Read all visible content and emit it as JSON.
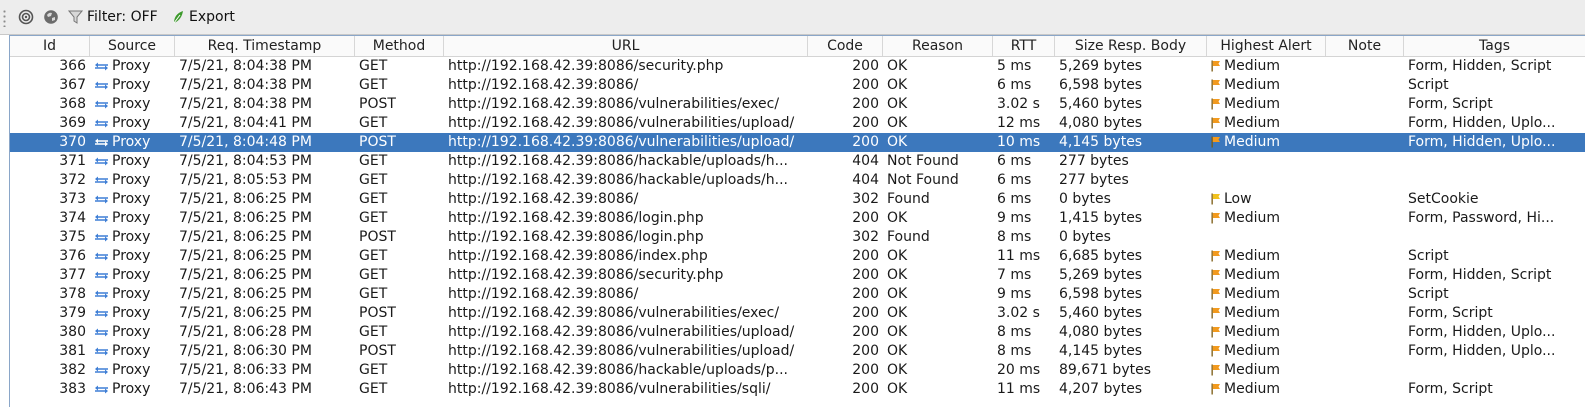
{
  "toolbar": {
    "filter_label": "Filter: OFF",
    "export_label": "Export"
  },
  "columns": [
    "Id",
    "Source",
    "Req. Timestamp",
    "Method",
    "URL",
    "Code",
    "Reason",
    "RTT",
    "Size Resp. Body",
    "Highest Alert",
    "Note",
    "Tags"
  ],
  "colors": {
    "selected_row": "#3c78bd",
    "arrow": "#3f7fd6",
    "medium_flag": "#f29a1e",
    "low_flag": "#f2c21e"
  },
  "rows": [
    {
      "id": "366",
      "source": "Proxy",
      "timestamp": "7/5/21, 8:04:38 PM",
      "method": "GET",
      "url": "http://192.168.42.39:8086/security.php",
      "code": "200",
      "reason": "OK",
      "rtt": "5 ms",
      "size": "5,269 bytes",
      "alert": "Medium",
      "note": "",
      "tags": "Form, Hidden, Script"
    },
    {
      "id": "367",
      "source": "Proxy",
      "timestamp": "7/5/21, 8:04:38 PM",
      "method": "GET",
      "url": "http://192.168.42.39:8086/",
      "code": "200",
      "reason": "OK",
      "rtt": "6 ms",
      "size": "6,598 bytes",
      "alert": "Medium",
      "note": "",
      "tags": "Script"
    },
    {
      "id": "368",
      "source": "Proxy",
      "timestamp": "7/5/21, 8:04:38 PM",
      "method": "POST",
      "url": "http://192.168.42.39:8086/vulnerabilities/exec/",
      "code": "200",
      "reason": "OK",
      "rtt": "3.02 s",
      "size": "5,460 bytes",
      "alert": "Medium",
      "note": "",
      "tags": "Form, Script"
    },
    {
      "id": "369",
      "source": "Proxy",
      "timestamp": "7/5/21, 8:04:41 PM",
      "method": "GET",
      "url": "http://192.168.42.39:8086/vulnerabilities/upload/",
      "code": "200",
      "reason": "OK",
      "rtt": "12 ms",
      "size": "4,080 bytes",
      "alert": "Medium",
      "note": "",
      "tags": "Form, Hidden, Uplo..."
    },
    {
      "id": "370",
      "source": "Proxy",
      "timestamp": "7/5/21, 8:04:48 PM",
      "method": "POST",
      "url": "http://192.168.42.39:8086/vulnerabilities/upload/",
      "code": "200",
      "reason": "OK",
      "rtt": "10 ms",
      "size": "4,145 bytes",
      "alert": "Medium",
      "note": "",
      "tags": "Form, Hidden, Uplo...",
      "selected": true
    },
    {
      "id": "371",
      "source": "Proxy",
      "timestamp": "7/5/21, 8:04:53 PM",
      "method": "GET",
      "url": "http://192.168.42.39:8086/hackable/uploads/h...",
      "code": "404",
      "reason": "Not Found",
      "rtt": "6 ms",
      "size": "277 bytes",
      "alert": "",
      "note": "",
      "tags": ""
    },
    {
      "id": "372",
      "source": "Proxy",
      "timestamp": "7/5/21, 8:05:53 PM",
      "method": "GET",
      "url": "http://192.168.42.39:8086/hackable/uploads/h...",
      "code": "404",
      "reason": "Not Found",
      "rtt": "6 ms",
      "size": "277 bytes",
      "alert": "",
      "note": "",
      "tags": ""
    },
    {
      "id": "373",
      "source": "Proxy",
      "timestamp": "7/5/21, 8:06:25 PM",
      "method": "GET",
      "url": "http://192.168.42.39:8086/",
      "code": "302",
      "reason": "Found",
      "rtt": "6 ms",
      "size": "0 bytes",
      "alert": "Low",
      "note": "",
      "tags": "SetCookie"
    },
    {
      "id": "374",
      "source": "Proxy",
      "timestamp": "7/5/21, 8:06:25 PM",
      "method": "GET",
      "url": "http://192.168.42.39:8086/login.php",
      "code": "200",
      "reason": "OK",
      "rtt": "9 ms",
      "size": "1,415 bytes",
      "alert": "Medium",
      "note": "",
      "tags": "Form, Password, Hi..."
    },
    {
      "id": "375",
      "source": "Proxy",
      "timestamp": "7/5/21, 8:06:25 PM",
      "method": "POST",
      "url": "http://192.168.42.39:8086/login.php",
      "code": "302",
      "reason": "Found",
      "rtt": "8 ms",
      "size": "0 bytes",
      "alert": "",
      "note": "",
      "tags": ""
    },
    {
      "id": "376",
      "source": "Proxy",
      "timestamp": "7/5/21, 8:06:25 PM",
      "method": "GET",
      "url": "http://192.168.42.39:8086/index.php",
      "code": "200",
      "reason": "OK",
      "rtt": "11 ms",
      "size": "6,685 bytes",
      "alert": "Medium",
      "note": "",
      "tags": "Script"
    },
    {
      "id": "377",
      "source": "Proxy",
      "timestamp": "7/5/21, 8:06:25 PM",
      "method": "GET",
      "url": "http://192.168.42.39:8086/security.php",
      "code": "200",
      "reason": "OK",
      "rtt": "7 ms",
      "size": "5,269 bytes",
      "alert": "Medium",
      "note": "",
      "tags": "Form, Hidden, Script"
    },
    {
      "id": "378",
      "source": "Proxy",
      "timestamp": "7/5/21, 8:06:25 PM",
      "method": "GET",
      "url": "http://192.168.42.39:8086/",
      "code": "200",
      "reason": "OK",
      "rtt": "9 ms",
      "size": "6,598 bytes",
      "alert": "Medium",
      "note": "",
      "tags": "Script"
    },
    {
      "id": "379",
      "source": "Proxy",
      "timestamp": "7/5/21, 8:06:25 PM",
      "method": "POST",
      "url": "http://192.168.42.39:8086/vulnerabilities/exec/",
      "code": "200",
      "reason": "OK",
      "rtt": "3.02 s",
      "size": "5,460 bytes",
      "alert": "Medium",
      "note": "",
      "tags": "Form, Script"
    },
    {
      "id": "380",
      "source": "Proxy",
      "timestamp": "7/5/21, 8:06:28 PM",
      "method": "GET",
      "url": "http://192.168.42.39:8086/vulnerabilities/upload/",
      "code": "200",
      "reason": "OK",
      "rtt": "8 ms",
      "size": "4,080 bytes",
      "alert": "Medium",
      "note": "",
      "tags": "Form, Hidden, Uplo..."
    },
    {
      "id": "381",
      "source": "Proxy",
      "timestamp": "7/5/21, 8:06:30 PM",
      "method": "POST",
      "url": "http://192.168.42.39:8086/vulnerabilities/upload/",
      "code": "200",
      "reason": "OK",
      "rtt": "8 ms",
      "size": "4,145 bytes",
      "alert": "Medium",
      "note": "",
      "tags": "Form, Hidden, Uplo..."
    },
    {
      "id": "382",
      "source": "Proxy",
      "timestamp": "7/5/21, 8:06:33 PM",
      "method": "GET",
      "url": "http://192.168.42.39:8086/hackable/uploads/p...",
      "code": "200",
      "reason": "OK",
      "rtt": "20 ms",
      "size": "89,671 bytes",
      "alert": "Medium",
      "note": "",
      "tags": ""
    },
    {
      "id": "383",
      "source": "Proxy",
      "timestamp": "7/5/21, 8:06:43 PM",
      "method": "GET",
      "url": "http://192.168.42.39:8086/vulnerabilities/sqli/",
      "code": "200",
      "reason": "OK",
      "rtt": "11 ms",
      "size": "4,207 bytes",
      "alert": "Medium",
      "note": "",
      "tags": "Form, Script"
    }
  ]
}
